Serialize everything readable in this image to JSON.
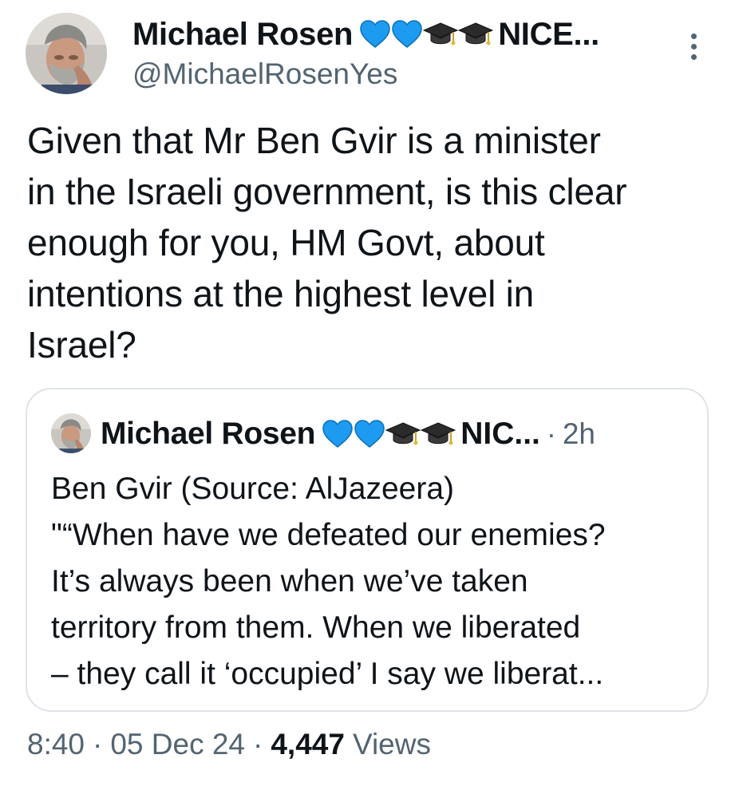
{
  "tweet": {
    "author": {
      "display_name": "Michael Rosen",
      "name_suffix": "NICE...",
      "handle": "@MichaelRosenYes",
      "name_emojis": [
        "blue-heart-icon",
        "blue-heart-icon",
        "graduation-cap-icon",
        "graduation-cap-icon"
      ]
    },
    "more_icon": "more-vertical-icon",
    "text_lines": [
      "Given that Mr Ben Gvir is a minister",
      "in the Israeli government, is this clear",
      "enough for you, HM Govt, about",
      "intentions at the highest level in",
      "Israel?"
    ],
    "quoted": {
      "display_name": "Michael Rosen",
      "name_suffix": "NIC...",
      "separator": "·",
      "time": "2h",
      "name_emojis": [
        "blue-heart-icon",
        "blue-heart-icon",
        "graduation-cap-icon",
        "graduation-cap-icon"
      ],
      "text_lines": [
        "Ben Gvir (Source: AlJazeera)",
        "\"“When have we defeated our enemies?",
        "It’s always been when we’ve taken",
        "territory from them. When we liberated",
        "– they call it ‘occupied’ I say we liberat..."
      ]
    },
    "meta": {
      "time": "8:40",
      "separator": "·",
      "date": "05 Dec 24",
      "views_count": "4,447",
      "views_label": "Views"
    }
  },
  "colors": {
    "text": "#0f1419",
    "secondary": "#536471",
    "border": "#dfe3e7",
    "heart": "#1d9bf0"
  }
}
